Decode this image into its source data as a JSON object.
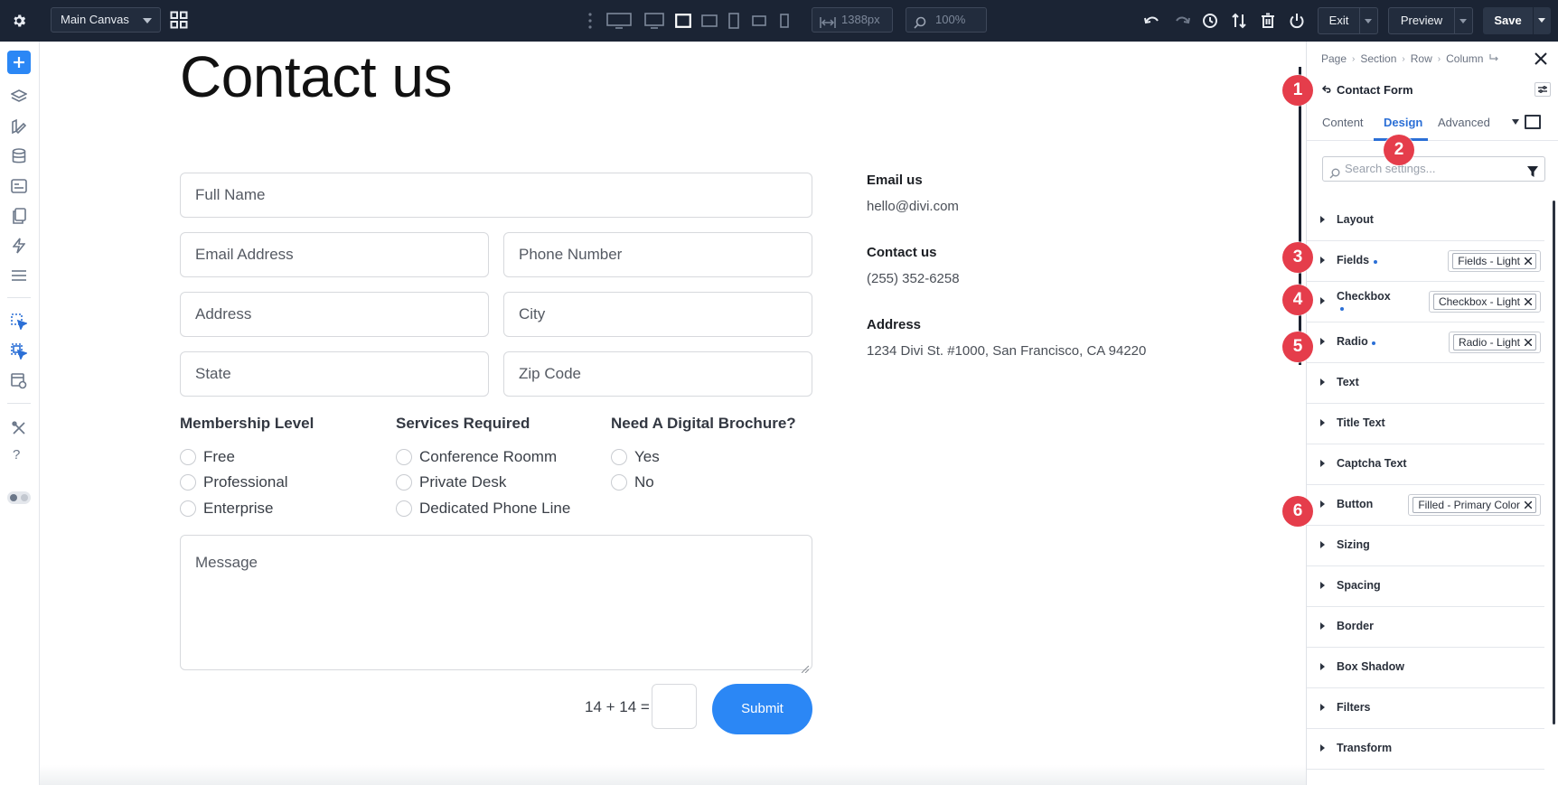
{
  "topbar": {
    "canvas_select": "Main Canvas",
    "width_value": "1388px",
    "zoom_value": "100%",
    "exit_label": "Exit",
    "preview_label": "Preview",
    "save_label": "Save"
  },
  "canvas": {
    "title": "Contact us",
    "fields": {
      "full_name": "Full Name",
      "email": "Email Address",
      "phone": "Phone Number",
      "address": "Address",
      "city": "City",
      "state": "State",
      "zip": "Zip Code",
      "message": "Message"
    },
    "groups": [
      {
        "title": "Membership Level",
        "options": [
          "Free",
          "Professional",
          "Enterprise"
        ]
      },
      {
        "title": "Services Required",
        "options": [
          "Conference Roomm",
          "Private Desk",
          "Dedicated Phone Line"
        ]
      },
      {
        "title": "Need A Digital Brochure?",
        "options": [
          "Yes",
          "No"
        ]
      }
    ],
    "captcha": "14 + 14 =",
    "submit_label": "Submit",
    "info": {
      "email_heading": "Email us",
      "email_value": "hello@divi.com",
      "contact_heading": "Contact us",
      "contact_value": "(255) 352-6258",
      "address_heading": "Address",
      "address_value": "1234 Divi St. #1000, San Francisco, CA 94220"
    }
  },
  "panel": {
    "breadcrumbs": [
      "Page",
      "Section",
      "Row",
      "Column"
    ],
    "module_title": "Contact Form",
    "tabs": [
      "Content",
      "Design",
      "Advanced"
    ],
    "search_placeholder": "Search settings...",
    "groups": [
      {
        "label": "Layout"
      },
      {
        "label": "Fields",
        "preset": "Fields - Light"
      },
      {
        "label": "Checkbox",
        "preset": "Checkbox - Light"
      },
      {
        "label": "Radio",
        "preset": "Radio - Light"
      },
      {
        "label": "Text"
      },
      {
        "label": "Title Text"
      },
      {
        "label": "Captcha Text"
      },
      {
        "label": "Button",
        "preset": "Filled - Primary Color"
      },
      {
        "label": "Sizing"
      },
      {
        "label": "Spacing"
      },
      {
        "label": "Border"
      },
      {
        "label": "Box Shadow"
      },
      {
        "label": "Filters"
      },
      {
        "label": "Transform"
      }
    ]
  },
  "badges": [
    "1",
    "2",
    "3",
    "4",
    "5",
    "6"
  ],
  "colors": {
    "topbar_bg": "#1b2434",
    "accent_blue": "#2b87f5",
    "tab_active": "#2b6fd6",
    "badge_red": "#e53d4b"
  }
}
